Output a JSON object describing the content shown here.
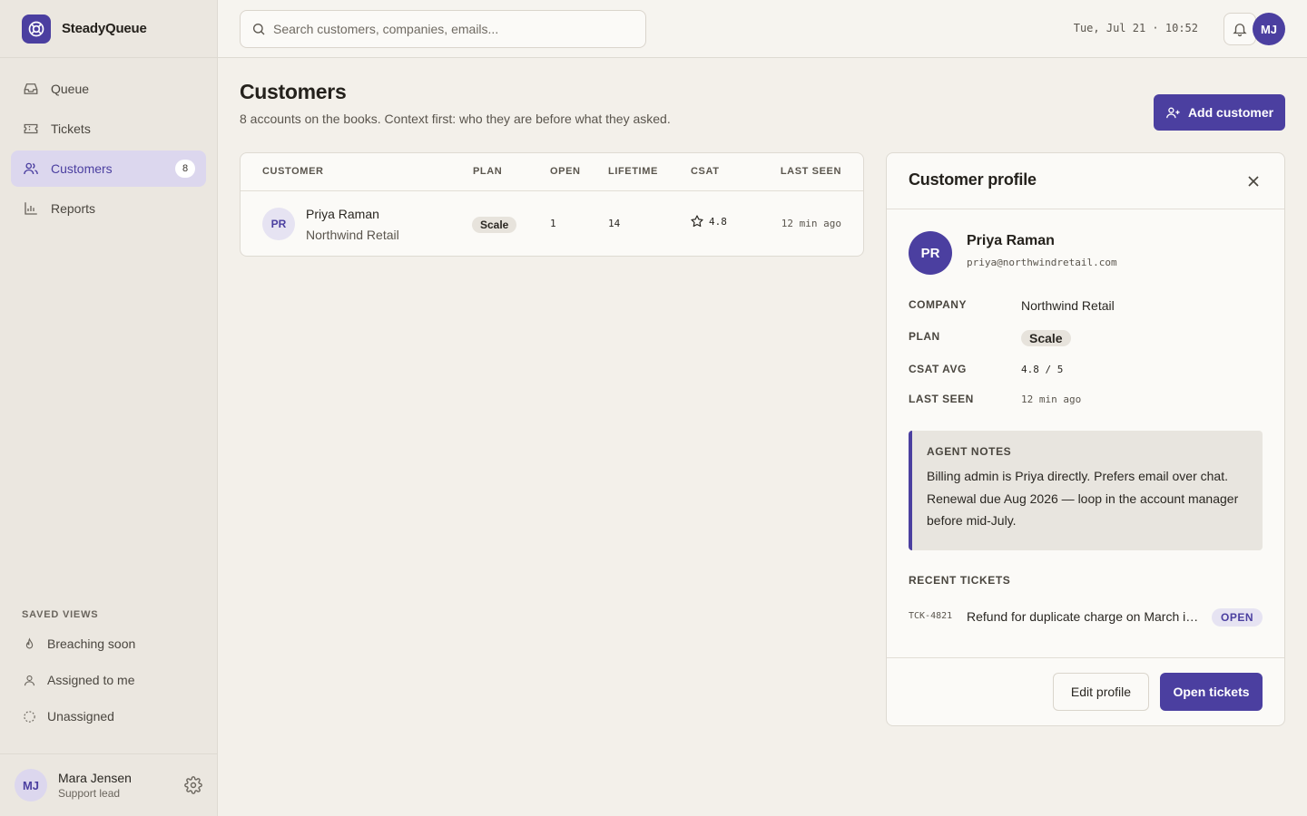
{
  "app": {
    "name": "SteadyQueue",
    "accent": "#4b3fa0"
  },
  "sidebar": {
    "items": [
      {
        "label": "Queue",
        "icon": "inbox-icon"
      },
      {
        "label": "Tickets",
        "icon": "ticket-icon"
      },
      {
        "label": "Customers",
        "icon": "users-icon",
        "badge": "8",
        "active": true
      },
      {
        "label": "Reports",
        "icon": "bar-chart-icon"
      }
    ],
    "saved_views_title": "SAVED VIEWS",
    "saved_views": [
      {
        "label": "Breaching soon",
        "icon": "flame-icon"
      },
      {
        "label": "Assigned to me",
        "icon": "user-icon"
      },
      {
        "label": "Unassigned",
        "icon": "dashed-circle-icon"
      }
    ],
    "user": {
      "initials": "MJ",
      "name": "Mara Jensen",
      "role": "Support lead"
    }
  },
  "topbar": {
    "search_placeholder": "Search customers, companies, emails...",
    "datetime": "Tue, Jul 21 · 10:52",
    "avatar_initials": "MJ"
  },
  "page": {
    "title": "Customers",
    "subtitle": "8 accounts on the books. Context first: who they are before what they asked.",
    "add_button": "Add customer"
  },
  "table": {
    "headers": [
      "CUSTOMER",
      "PLAN",
      "OPEN",
      "LIFETIME",
      "CSAT",
      "LAST SEEN"
    ],
    "rows": [
      {
        "initials": "PR",
        "name": "Priya Raman",
        "company": "Northwind Retail",
        "plan": "Scale",
        "open": "1",
        "lifetime": "14",
        "csat": "4.8",
        "last_seen": "12 min ago"
      }
    ]
  },
  "profile": {
    "title": "Customer profile",
    "initials": "PR",
    "name": "Priya Raman",
    "email": "priya@northwindretail.com",
    "fields": {
      "company_label": "COMPANY",
      "company": "Northwind Retail",
      "plan_label": "PLAN",
      "plan": "Scale",
      "csat_label": "CSAT AVG",
      "csat": "4.8 / 5",
      "last_seen_label": "LAST SEEN",
      "last_seen": "12 min ago"
    },
    "notes_title": "AGENT NOTES",
    "notes": "Billing admin is Priya directly. Prefers email over chat. Renewal due Aug 2026 — loop in the account manager before mid-July.",
    "recent_title": "RECENT TICKETS",
    "recent": [
      {
        "id": "TCK-4821",
        "subject": "Refund for duplicate charge on March invoice",
        "status": "OPEN"
      }
    ],
    "edit_button": "Edit profile",
    "open_button": "Open tickets"
  }
}
